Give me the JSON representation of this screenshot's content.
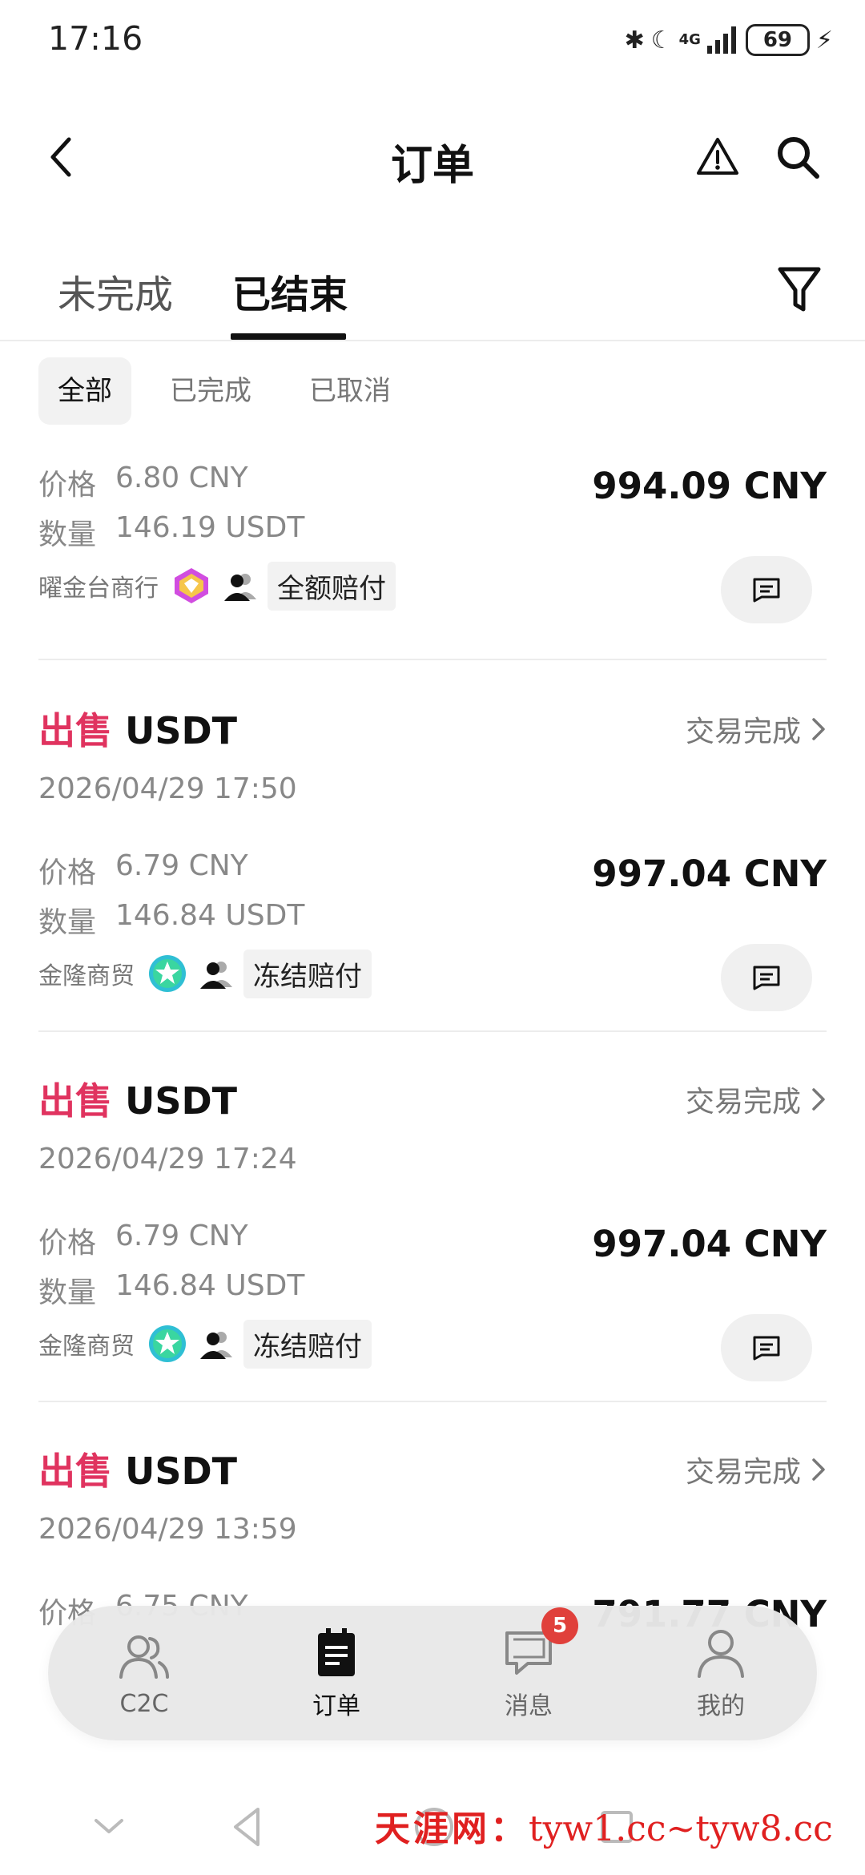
{
  "status_bar": {
    "time": "17:16",
    "network": "4G",
    "battery": "69"
  },
  "header": {
    "title": "订单"
  },
  "tabs": [
    {
      "label": "未完成"
    },
    {
      "label": "已结束"
    }
  ],
  "subtabs": [
    {
      "label": "全部"
    },
    {
      "label": "已完成"
    },
    {
      "label": "已取消"
    }
  ],
  "labels": {
    "price": "价格",
    "quantity": "数量"
  },
  "first_order": {
    "price": "6.80 CNY",
    "quantity": "146.19 USDT",
    "total": "994.09 CNY",
    "merchant": "曜金台商行",
    "guarantee": "全额赔付"
  },
  "orders": [
    {
      "side": "出售",
      "asset": "USDT",
      "status": "交易完成",
      "date": "2026/04/29 17:50",
      "price": "6.79 CNY",
      "quantity": "146.84 USDT",
      "total": "997.04 CNY",
      "merchant": "金隆商贸",
      "guarantee": "冻结赔付"
    },
    {
      "side": "出售",
      "asset": "USDT",
      "status": "交易完成",
      "date": "2026/04/29 17:24",
      "price": "6.79 CNY",
      "quantity": "146.84 USDT",
      "total": "997.04 CNY",
      "merchant": "金隆商贸",
      "guarantee": "冻结赔付"
    },
    {
      "side": "出售",
      "asset": "USDT",
      "status": "交易完成",
      "date": "2026/04/29 13:59",
      "price": "6.75 CNY",
      "quantity": "",
      "total": "791.77 CNY",
      "merchant": "",
      "guarantee": ""
    }
  ],
  "bottom_nav": [
    {
      "label": "C2C",
      "icon": "people-icon"
    },
    {
      "label": "订单",
      "icon": "orders-icon"
    },
    {
      "label": "消息",
      "icon": "message-icon",
      "badge": "5"
    },
    {
      "label": "我的",
      "icon": "person-icon"
    }
  ],
  "watermark": {
    "site": "天涯网：",
    "domains": "tyw1.cc~tyw8.cc"
  },
  "colors": {
    "sell": "#e0335f",
    "badge": "#e0403b",
    "watermark": "#e02020"
  }
}
